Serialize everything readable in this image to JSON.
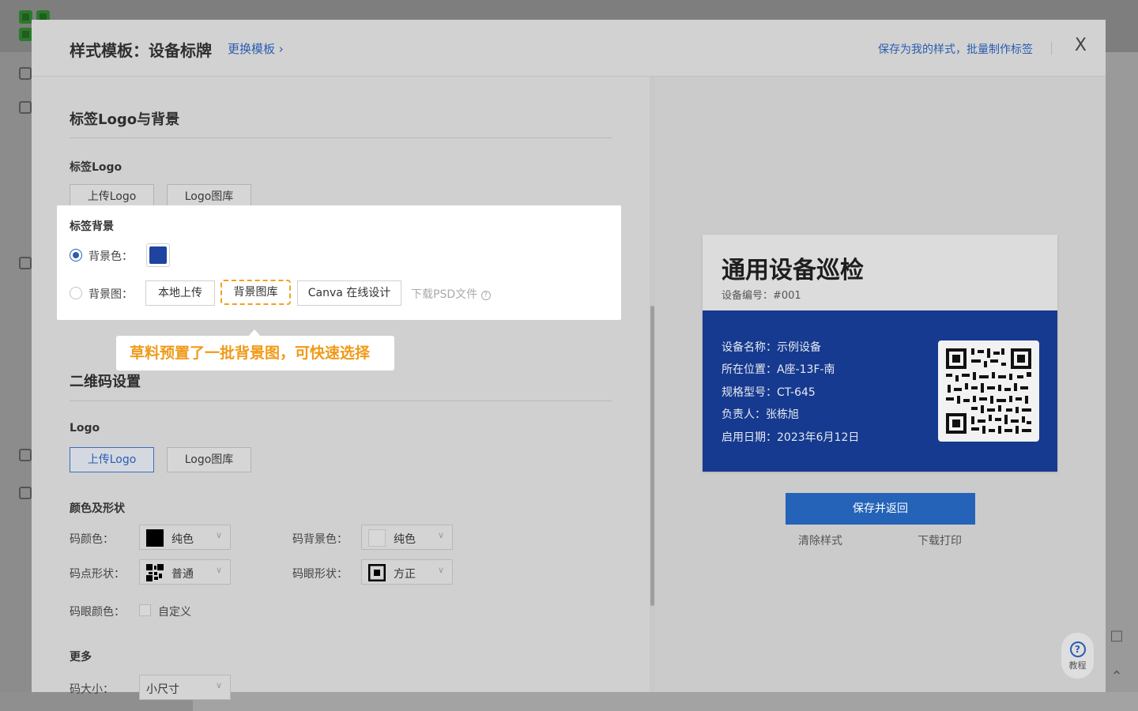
{
  "modal": {
    "title": "样式模板：设备标牌",
    "change_template": "更换模板 ›",
    "save_my_style": "保存为我的样式，批量制作标签",
    "close": "X"
  },
  "logo_bg_section": {
    "title": "标签Logo与背景",
    "label_logo": "标签Logo",
    "upload_logo": "上传Logo",
    "logo_gallery": "Logo图库",
    "label_bg": "标签背景",
    "bg_color_label": "背景色：",
    "bg_color": "#1f43a0",
    "bg_image_label": "背景图：",
    "local_upload": "本地上传",
    "bg_gallery": "背景图库",
    "canva": "Canva 在线设计",
    "download_psd": "下载PSD文件",
    "help_mark": "?"
  },
  "tooltip": "草料预置了一批背景图，可快速选择",
  "qr_section": {
    "title": "二维码设置",
    "logo_label": "Logo",
    "upload_logo": "上传Logo",
    "logo_gallery": "Logo图库",
    "color_shape_title": "颜色及形状",
    "code_color_label": "码颜色：",
    "code_color_value": "纯色",
    "code_bg_color_label": "码背景色：",
    "code_bg_color_value": "纯色",
    "dot_shape_label": "码点形状：",
    "dot_shape_value": "普通",
    "eye_shape_label": "码眼形状：",
    "eye_shape_value": "方正",
    "eye_color_label": "码眼颜色：",
    "eye_color_value": "自定义",
    "more_title": "更多",
    "size_label": "码大小：",
    "size_value": "小尺寸"
  },
  "preview": {
    "title": "通用设备巡检",
    "device_id": "设备编号：#001",
    "lines": [
      "设备名称：示例设备",
      "所在位置：A座-13F-南",
      "规格型号：CT-645",
      "负责人：张栋旭",
      "启用日期：2023年6月12日"
    ],
    "save_return": "保存并返回",
    "clear_style": "清除样式",
    "download_print": "下载打印"
  },
  "help": {
    "label": "教程",
    "glyph": "?"
  }
}
